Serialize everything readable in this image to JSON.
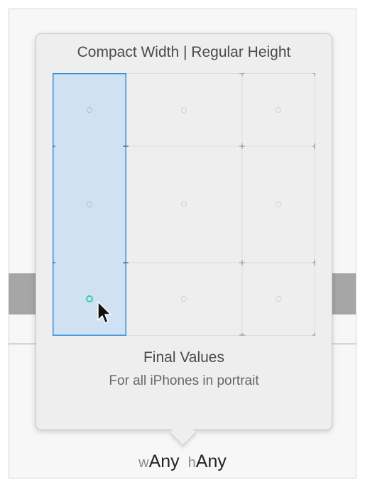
{
  "popover": {
    "title": "Compact Width | Regular Height",
    "result_title": "Final Values",
    "result_description": "For all iPhones in portrait"
  },
  "size_class_bar": {
    "width_prefix": "w",
    "width_value": "Any",
    "height_prefix": "h",
    "height_value": "Any"
  },
  "colors": {
    "selection_fill": "#cfe1f2",
    "selection_border": "#3a8fd8",
    "hover_dot": "#35d0a0"
  }
}
